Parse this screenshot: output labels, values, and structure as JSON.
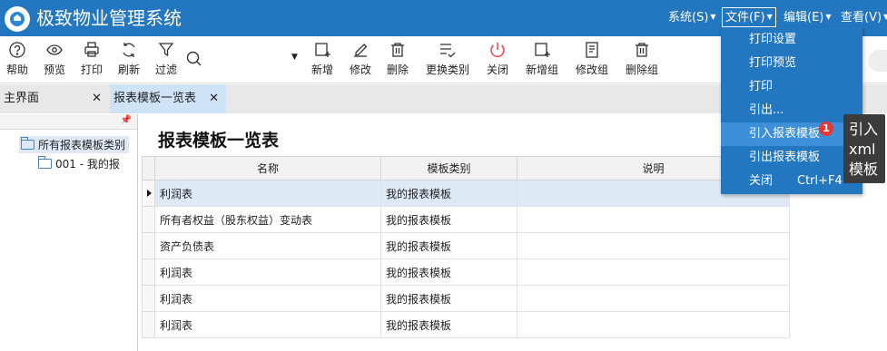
{
  "app": {
    "title": "极致物业管理系统"
  },
  "menubar": {
    "items": [
      {
        "label": "系统(S)"
      },
      {
        "label": "文件(F)"
      },
      {
        "label": "编辑(E)"
      },
      {
        "label": "查看(V)"
      }
    ]
  },
  "toolbar": {
    "help": "帮助",
    "preview": "预览",
    "print": "打印",
    "refresh": "刷新",
    "filter": "过滤",
    "add": "新增",
    "edit": "修改",
    "delete": "删除",
    "change_category": "更换类别",
    "close": "关闭",
    "add_group": "新增组",
    "edit_group": "修改组",
    "delete_group": "删除组"
  },
  "tabs": [
    {
      "label": "主界面",
      "close": "✕"
    },
    {
      "label": "报表模板一览表",
      "close": "✕"
    }
  ],
  "tree": {
    "pin": "ꟷ",
    "root": "所有报表模板类别",
    "child": "001 - 我的报"
  },
  "main": {
    "title": "报表模板一览表",
    "columns": [
      "名称",
      "模板类别",
      "说明"
    ],
    "rows": [
      {
        "name": "利润表",
        "category": "我的报表模板",
        "desc": ""
      },
      {
        "name": "所有者权益（股东权益）变动表",
        "category": "我的报表模板",
        "desc": ""
      },
      {
        "name": "资产负债表",
        "category": "我的报表模板",
        "desc": ""
      },
      {
        "name": "利润表",
        "category": "我的报表模板",
        "desc": ""
      },
      {
        "name": "利润表",
        "category": "我的报表模板",
        "desc": ""
      },
      {
        "name": "利润表",
        "category": "我的报表模板",
        "desc": ""
      }
    ]
  },
  "file_menu": {
    "items": [
      {
        "label": "打印设置",
        "shortcut": ""
      },
      {
        "label": "打印预览",
        "shortcut": ""
      },
      {
        "label": "打印",
        "shortcut": ""
      },
      {
        "label": "引出...",
        "shortcut": ""
      },
      {
        "label": "引入报表模板",
        "shortcut": ""
      },
      {
        "label": "引出报表模板",
        "shortcut": ""
      },
      {
        "label": "关闭",
        "shortcut": "Ctrl+F4"
      }
    ],
    "badge": "1",
    "tooltip": "引入xml模板"
  },
  "colors": {
    "brand": "#2277c0",
    "menu_hover": "#3d8fd8",
    "selected_row": "#ddeaf6",
    "badge": "#e53935"
  }
}
